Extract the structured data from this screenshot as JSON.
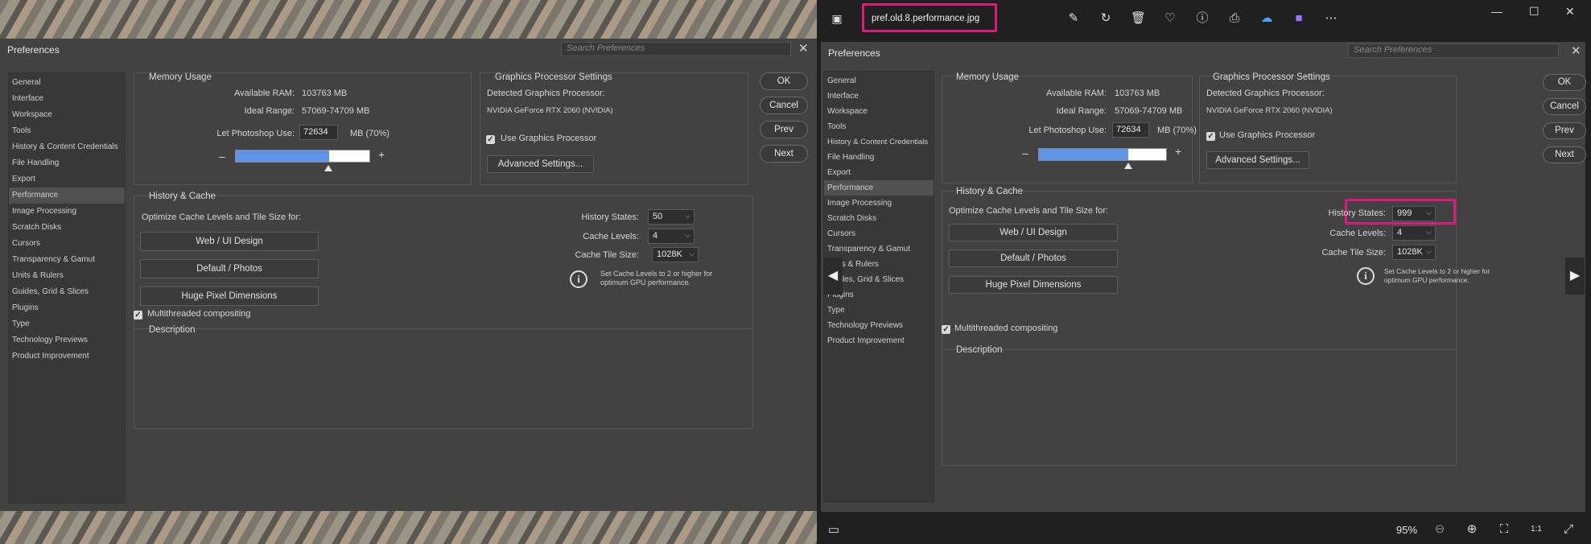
{
  "viewer": {
    "filename": "pref.old.8.performance.jpg",
    "zoom": "95%"
  },
  "prefs": {
    "title": "Preferences",
    "search_placeholder": "Search Preferences",
    "sidebar": [
      "General",
      "Interface",
      "Workspace",
      "Tools",
      "History & Content Credentials",
      "File Handling",
      "Export",
      "Performance",
      "Image Processing",
      "Scratch Disks",
      "Cursors",
      "Transparency & Gamut",
      "Units & Rulers",
      "Guides, Grid & Slices",
      "Plugins",
      "Type",
      "Technology Previews",
      "Product Improvement"
    ],
    "memory": {
      "title": "Memory Usage",
      "available_label": "Available RAM:",
      "available_value": "103763 MB",
      "ideal_label": "Ideal Range:",
      "ideal_value": "57069-74709 MB",
      "let_label": "Let Photoshop Use:",
      "let_value": "72634",
      "pct": "MB (70%)",
      "minus": "–",
      "plus": "+",
      "slider_fraction": 0.7
    },
    "gpu": {
      "title": "Graphics Processor Settings",
      "detected_label": "Detected Graphics Processor:",
      "detected_value": "NVIDIA GeForce RTX 2060 (NVIDIA)",
      "use_label": "Use Graphics Processor",
      "advanced": "Advanced Settings..."
    },
    "history": {
      "title": "History & Cache",
      "optimize": "Optimize Cache Levels and Tile Size for:",
      "btn_web": "Web / UI Design",
      "btn_default": "Default / Photos",
      "btn_huge": "Huge Pixel Dimensions",
      "states_label": "History States:",
      "states_left": "50",
      "states_right": "999",
      "cache_label": "Cache Levels:",
      "cache_value": "4",
      "tile_label": "Cache Tile Size:",
      "tile_value": "1028K",
      "note": "Set Cache Levels to 2 or higher for optimum GPU performance.",
      "chevron": "⌵"
    },
    "multithreaded": "Multithreaded compositing",
    "description": "Description",
    "buttons": {
      "ok": "OK",
      "cancel": "Cancel",
      "prev": "Prev",
      "next": "Next"
    },
    "check": "✓",
    "info_glyph": "i"
  },
  "colors": {
    "highlight": "#e0197d",
    "accent": "#5f94e8"
  }
}
